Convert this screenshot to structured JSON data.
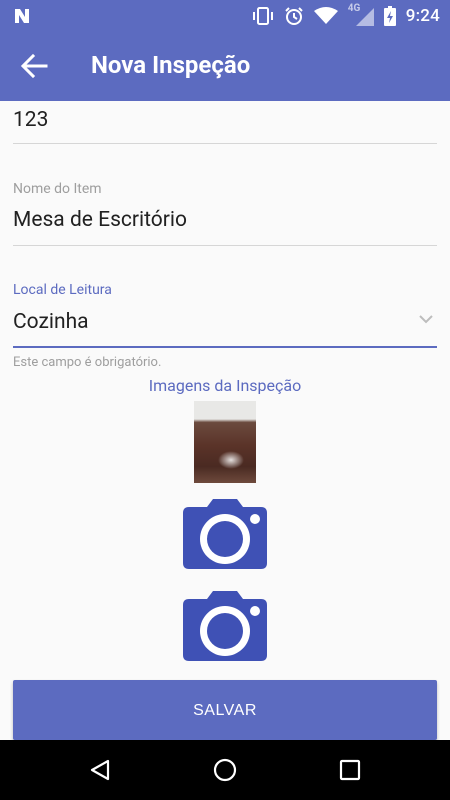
{
  "status_bar": {
    "time": "9:24",
    "network": "4G"
  },
  "app_bar": {
    "title": "Nova Inspeção"
  },
  "form": {
    "code_value": "123",
    "item_name": {
      "label": "Nome do Item",
      "value": "Mesa de Escritório"
    },
    "location": {
      "label": "Local de Leitura",
      "value": "Cozinha",
      "helper": "Este campo é obrigatório."
    }
  },
  "images": {
    "title": "Imagens da Inspeção"
  },
  "actions": {
    "save_label": "SALVAR"
  },
  "colors": {
    "primary": "#5c6bc0",
    "text": "#212121",
    "hint": "#9e9e9e",
    "divider": "#d6d6d6",
    "background": "#fafafa"
  },
  "icons": [
    "n-notification-icon",
    "vibrate-icon",
    "alarm-icon",
    "wifi-icon",
    "signal-icon",
    "battery-icon",
    "back-arrow-icon",
    "chevron-down-icon",
    "camera-icon",
    "nav-back-icon",
    "nav-home-icon",
    "nav-recents-icon"
  ]
}
